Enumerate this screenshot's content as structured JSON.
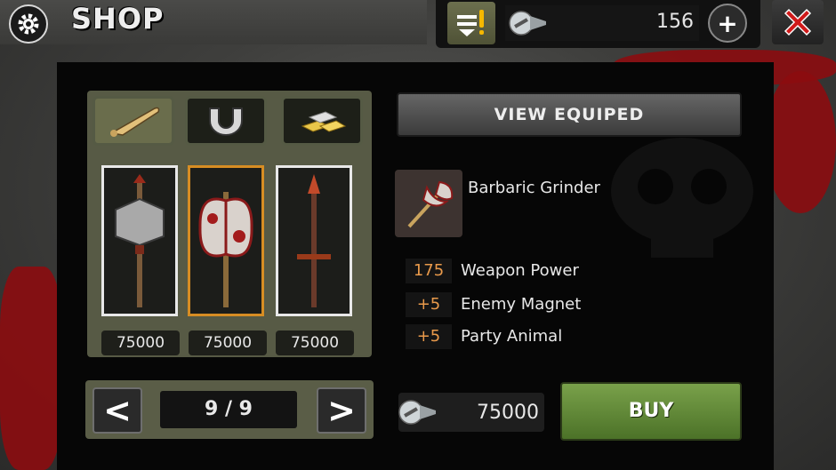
{
  "header": {
    "title": "SHOP",
    "currency_amount": "156",
    "plus_label": "+"
  },
  "colors": {
    "accent_orange": "#d78d23",
    "buy_green": "#5e8a33",
    "stat_value": "#e99a4b",
    "close_red": "#d01a1a"
  },
  "tabs": [
    {
      "icon": "bat-icon",
      "active": true
    },
    {
      "icon": "magnet-icon",
      "active": false
    },
    {
      "icon": "gold-bars-icon",
      "active": false
    }
  ],
  "items": [
    {
      "icon": "hammer-axe-icon",
      "price": "75000",
      "selected": false
    },
    {
      "icon": "double-axe-icon",
      "price": "75000",
      "selected": true
    },
    {
      "icon": "spear-icon",
      "price": "75000",
      "selected": false
    }
  ],
  "pager": {
    "prev_label": "<",
    "next_label": ">",
    "page_text": "9 / 9"
  },
  "detail": {
    "view_button_label": "VIEW EQUIPED",
    "item_name": "Barbaric Grinder",
    "stats": [
      {
        "value": "175",
        "label": "Weapon Power"
      },
      {
        "value": "+5",
        "label": "Enemy Magnet"
      },
      {
        "value": "+5",
        "label": "Party Animal"
      }
    ],
    "cost": "75000",
    "buy_label": "BUY"
  }
}
